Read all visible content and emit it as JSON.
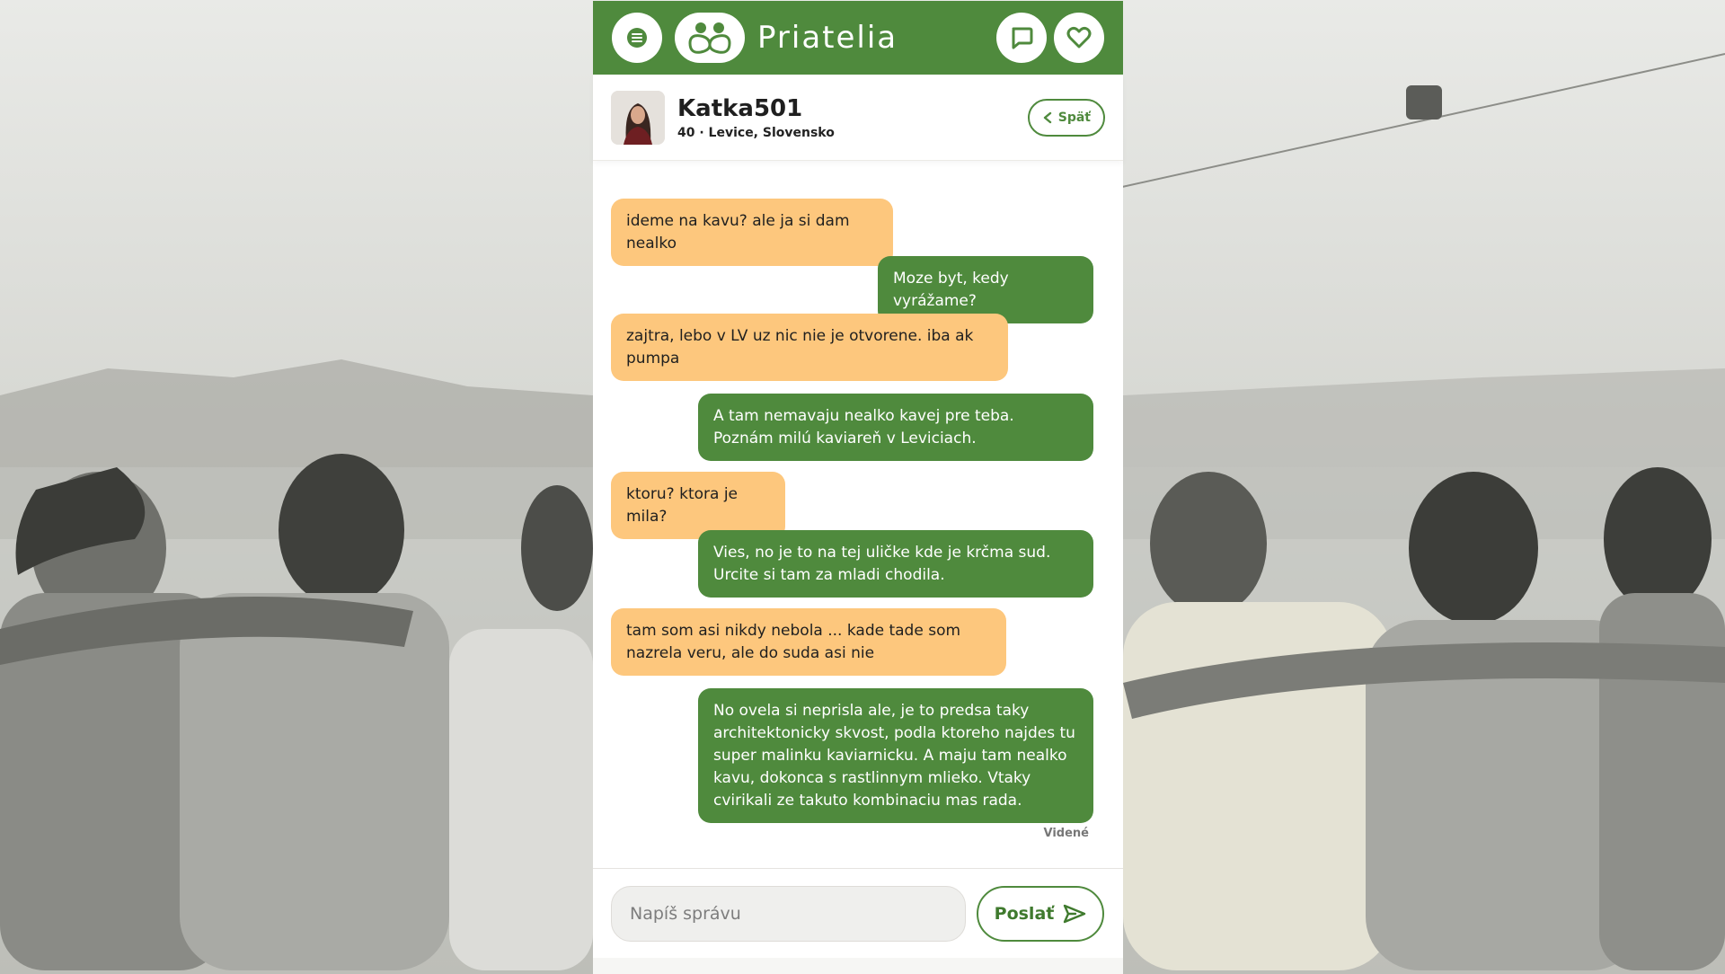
{
  "header": {
    "brand": "Priatelia",
    "menu_icon": "hamburger-menu-icon",
    "logo_icon": "friends-logo-icon",
    "messages_icon": "chat-bubble-icon",
    "favorites_icon": "heart-icon",
    "accent_color": "#4f8a3d"
  },
  "profile": {
    "name": "Katka501",
    "details": "40 · Levice, Slovensko",
    "back_label": "Späť"
  },
  "messages": [
    {
      "from": "them",
      "text": "ideme na kavu? ale ja si dam nealko"
    },
    {
      "from": "me",
      "text": "Moze byt, kedy vyrážame?"
    },
    {
      "from": "them",
      "text": "zajtra, lebo v LV uz nic nie je otvorene. iba ak pumpa"
    },
    {
      "from": "me",
      "text": "A tam nemavaju nealko kavej pre teba. Poznám milú kaviareň v Leviciach."
    },
    {
      "from": "them",
      "text": "ktoru? ktora je mila?"
    },
    {
      "from": "me",
      "text": "Vies, no je to na tej uličke kde je krčma sud. Urcite si tam za mladi chodila."
    },
    {
      "from": "them",
      "text": "tam som asi nikdy nebola ... kade tade som nazrela veru, ale do suda asi nie"
    },
    {
      "from": "me",
      "text": "No ovela si neprisla ale, je to predsa taky architektonicky skvost, podla ktoreho najdes tu super malinku kaviarnicku. A maju tam nealko kavu, dokonca s rastlinnym mlieko. Vtaky cvirikali ze takuto kombinaciu mas rada."
    }
  ],
  "status": {
    "seen": "Videné"
  },
  "composer": {
    "placeholder": "Napíš správu",
    "send_label": "Poslať"
  },
  "colors": {
    "incoming_bubble": "#fdc77d",
    "outgoing_bubble": "#4f8a3d"
  }
}
